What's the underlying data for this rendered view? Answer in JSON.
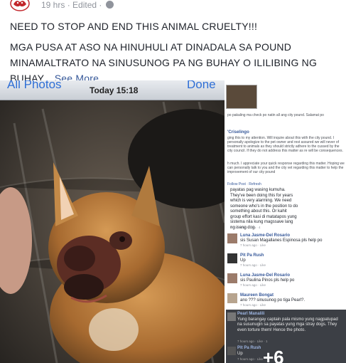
{
  "header": {
    "time": "19 hrs",
    "edited": "Edited",
    "separator": "·"
  },
  "post": {
    "line1": "NEED TO STOP AND END THIS ANIMAL CRUELTY!!!",
    "line2": "MGA PUSA AT ASO NA HINUHULI AT DINADALA SA POUND MINAMALTRATO NA SINUSUNOG PA NG BUHAY O ILILIBING NG BUHAY...",
    "see_more": "See More"
  },
  "photo_left": {
    "ios_left": "All Photos",
    "ios_center": "Today 15:18",
    "ios_right": "Done"
  },
  "photo_right": {
    "top_line": "po pakaling ma check po natin all ang city pound. Salamat po",
    "org_name": "'Criselingo",
    "reply1": "ging this to my attention. Will inquire about this with the city pound. I personally apologize to the pet owner and rest assured we will never of treatment to animals as they should strictly adhere to the cussed by the city council. If they do not address this matter as re will be consequences.",
    "reply2": "h much. I appreciate your quick response regarding this matter. Hoping we can personally talk to you and the city vet regarding this matter to help the improvement of our city pound",
    "links": "Follow Post · Refresh",
    "comment_block": "payatas pag wasing kumuha. They've been doing this for years which is very alarming. We need someone who's in the position to do something about this. Or kahit group effort kasi di matatapos yung sistema nila kung magssave lang ng isang dog.",
    "comment_block_time": "7 hours ago · Like · 4",
    "comments": [
      {
        "name": "Luna Jasme-Del Rosario",
        "body": "sis Susan Magallanes Espinosa pls help po",
        "time": "7 hours ago · Like"
      },
      {
        "name": "Pit Pa Rush",
        "body": "Up",
        "time": "7 hours ago · Like"
      },
      {
        "name": "Luna Jasme-Del Rosario",
        "body": "sis Paulina Pinos pls help po",
        "time": "7 hours ago · Like"
      },
      {
        "name": "Maureen Bongat",
        "body": "ano ??? sinusunog po tiga Pearl?.",
        "time": "7 hours ago · Like"
      }
    ],
    "dark_name": "Pearl Manalili",
    "dark_body": "Yung barangay captain pala mismo yung nagpatupad na susunugin sa payatas yung mga stray dogs. They even torture them! Hence the photo.",
    "dark_time": "7 hours ago · Like · 1",
    "dark_name2": "Pit Pa Rush",
    "dark_body2": "Up",
    "dark_time2": "7 hours ago · Like",
    "overlay_text": "+6"
  },
  "colors": {
    "link": "#365899",
    "meta": "#90949c",
    "text": "#1d2129"
  }
}
